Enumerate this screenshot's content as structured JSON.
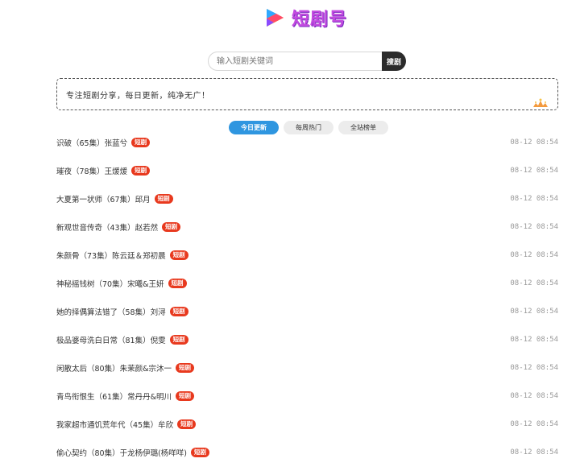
{
  "brand": {
    "name": "短剧号",
    "accent": "#c44be0"
  },
  "search": {
    "placeholder": "输入短剧关键词",
    "button_label": "搜剧"
  },
  "notice": {
    "text": "专注短剧分享，每日更新，纯净无广！"
  },
  "tabs": [
    {
      "label": "今日更新",
      "active": true
    },
    {
      "label": "每周热门",
      "active": false
    },
    {
      "label": "全站榜单",
      "active": false
    }
  ],
  "items": [
    {
      "title": "识破（65集）张蓝兮",
      "badge": "短剧",
      "time": "08-12 08:54"
    },
    {
      "title": "璀夜（78集）王煖煖",
      "badge": "短剧",
      "time": "08-12 08:54"
    },
    {
      "title": "大夏第一状师（67集）邱月",
      "badge": "短剧",
      "time": "08-12 08:54"
    },
    {
      "title": "新观世音传奇（43集）赵若然",
      "badge": "短剧",
      "time": "08-12 08:54"
    },
    {
      "title": "朱颜骨（73集）陈云廷＆郑初晨",
      "badge": "短剧",
      "time": "08-12 08:54"
    },
    {
      "title": "神秘摇钱树（70集）宋曦&王妍",
      "badge": "短剧",
      "time": "08-12 08:54"
    },
    {
      "title": "她的择偶算法错了（58集）刘浔",
      "badge": "短剧",
      "time": "08-12 08:54"
    },
    {
      "title": "极品婆母洗白日常（81集）倪雯",
      "badge": "短剧",
      "time": "08-12 08:54"
    },
    {
      "title": "闲散太后（80集）朱茉颜&宗沐一",
      "badge": "短剧",
      "time": "08-12 08:54"
    },
    {
      "title": "青鸟衔恨生（61集）常丹丹&明川",
      "badge": "短剧",
      "time": "08-12 08:54"
    },
    {
      "title": "我家超市通饥荒年代（45集）牟欣",
      "badge": "短剧",
      "time": "08-12 08:54"
    },
    {
      "title": "偷心契约（80集）于龙杨伊璐(杨咩咩)",
      "badge": "短剧",
      "time": "08-12 08:54"
    }
  ]
}
